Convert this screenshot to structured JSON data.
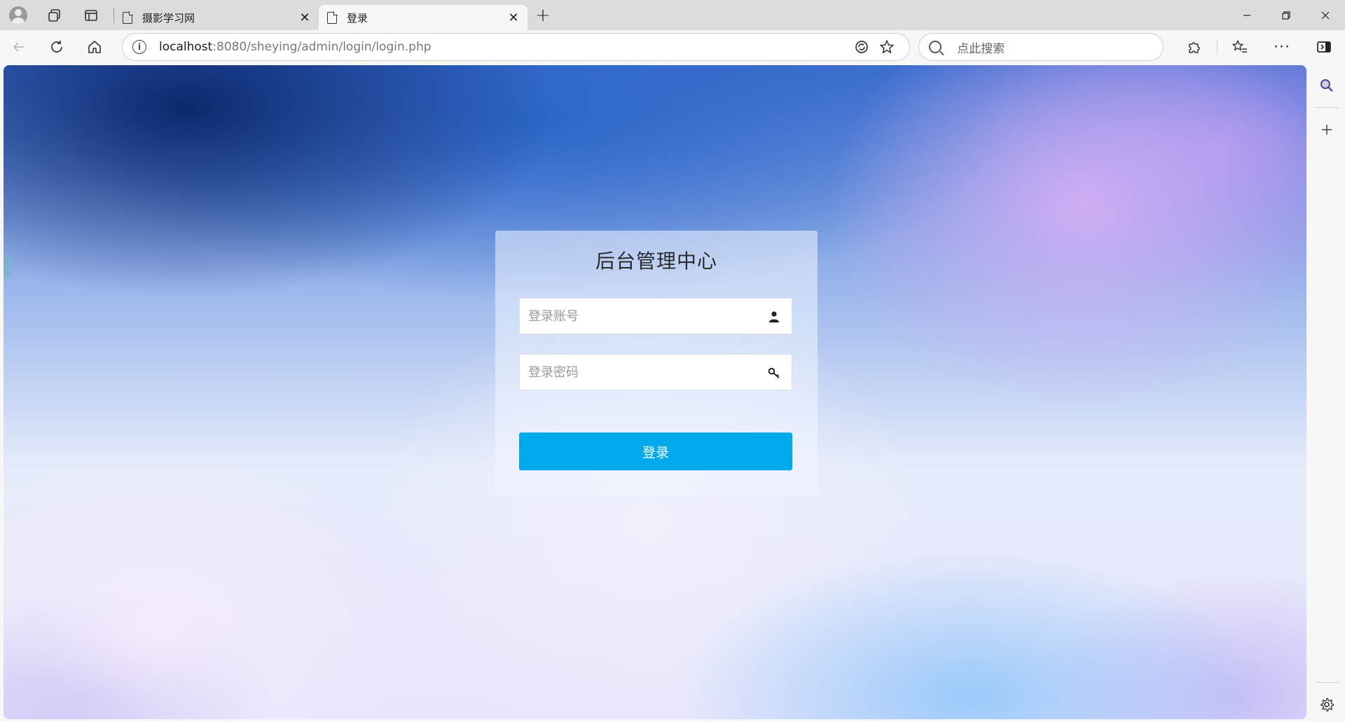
{
  "browser": {
    "tabs": [
      {
        "title": "摄影学习网",
        "active": false
      },
      {
        "title": "登录",
        "active": true
      }
    ],
    "address": {
      "host": "localhost",
      "rest": ":8080/sheying/admin/login/login.php"
    },
    "search": {
      "placeholder": "点此搜索"
    }
  },
  "login": {
    "title": "后台管理中心",
    "username_placeholder": "登录账号",
    "password_placeholder": "登录密码",
    "submit_label": "登录"
  },
  "icons": {
    "profile": "profile-avatar-icon",
    "workspaces": "workspaces-icon",
    "tab_actions": "tab-actions-icon",
    "page": "page-icon",
    "user": "user-icon",
    "key": "key-icon",
    "settings": "gear-icon"
  },
  "colors": {
    "login_button": "#00a8ec",
    "tabbar": "#dcdcdc"
  }
}
